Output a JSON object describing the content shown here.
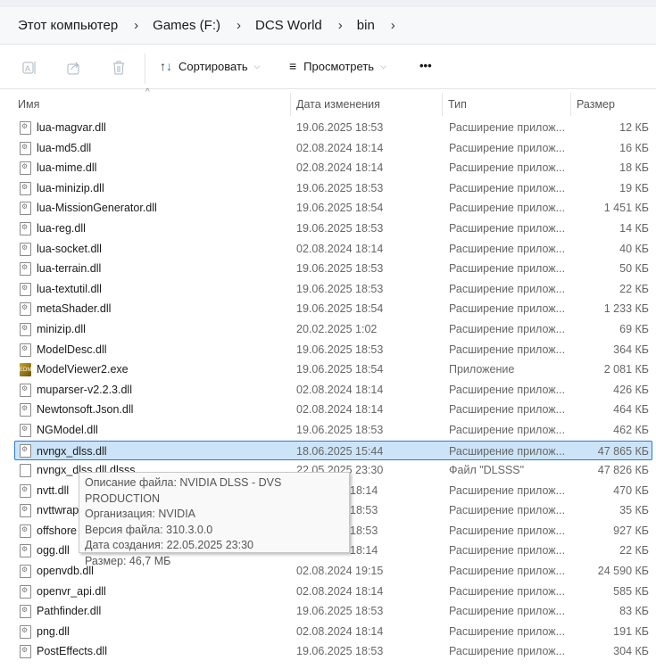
{
  "breadcrumb": [
    "Этот компьютер",
    "Games (F:)",
    "DCS World",
    "bin"
  ],
  "toolbar": {
    "sort_label": "Сортировать",
    "view_label": "Просмотреть",
    "more_label": "•••"
  },
  "columns": {
    "name": "Имя",
    "date": "Дата изменения",
    "type": "Тип",
    "size": "Размер"
  },
  "files": [
    {
      "name": "lua-magvar.dll",
      "date": "19.06.2025 18:53",
      "type": "Расширение прилож...",
      "size": "12 КБ",
      "icon": "dll"
    },
    {
      "name": "lua-md5.dll",
      "date": "02.08.2024 18:14",
      "type": "Расширение прилож...",
      "size": "16 КБ",
      "icon": "dll"
    },
    {
      "name": "lua-mime.dll",
      "date": "02.08.2024 18:14",
      "type": "Расширение прилож...",
      "size": "18 КБ",
      "icon": "dll"
    },
    {
      "name": "lua-minizip.dll",
      "date": "19.06.2025 18:53",
      "type": "Расширение прилож...",
      "size": "19 КБ",
      "icon": "dll"
    },
    {
      "name": "lua-MissionGenerator.dll",
      "date": "19.06.2025 18:54",
      "type": "Расширение прилож...",
      "size": "1 451 КБ",
      "icon": "dll"
    },
    {
      "name": "lua-reg.dll",
      "date": "19.06.2025 18:53",
      "type": "Расширение прилож...",
      "size": "14 КБ",
      "icon": "dll"
    },
    {
      "name": "lua-socket.dll",
      "date": "02.08.2024 18:14",
      "type": "Расширение прилож...",
      "size": "40 КБ",
      "icon": "dll"
    },
    {
      "name": "lua-terrain.dll",
      "date": "19.06.2025 18:53",
      "type": "Расширение прилож...",
      "size": "50 КБ",
      "icon": "dll"
    },
    {
      "name": "lua-textutil.dll",
      "date": "19.06.2025 18:53",
      "type": "Расширение прилож...",
      "size": "22 КБ",
      "icon": "dll"
    },
    {
      "name": "metaShader.dll",
      "date": "19.06.2025 18:54",
      "type": "Расширение прилож...",
      "size": "1 233 КБ",
      "icon": "dll"
    },
    {
      "name": "minizip.dll",
      "date": "20.02.2025 1:02",
      "type": "Расширение прилож...",
      "size": "69 КБ",
      "icon": "dll"
    },
    {
      "name": "ModelDesc.dll",
      "date": "19.06.2025 18:53",
      "type": "Расширение прилож...",
      "size": "364 КБ",
      "icon": "dll"
    },
    {
      "name": "ModelViewer2.exe",
      "date": "19.06.2025 18:54",
      "type": "Приложение",
      "size": "2 081 КБ",
      "icon": "exe"
    },
    {
      "name": "muparser-v2.2.3.dll",
      "date": "02.08.2024 18:14",
      "type": "Расширение прилож...",
      "size": "426 КБ",
      "icon": "dll"
    },
    {
      "name": "Newtonsoft.Json.dll",
      "date": "02.08.2024 18:14",
      "type": "Расширение прилож...",
      "size": "464 КБ",
      "icon": "dll"
    },
    {
      "name": "NGModel.dll",
      "date": "19.06.2025 18:53",
      "type": "Расширение прилож...",
      "size": "462 КБ",
      "icon": "dll"
    },
    {
      "name": "nvngx_dlss.dll",
      "date": "18.06.2025 15:44",
      "type": "Расширение прилож...",
      "size": "47 865 КБ",
      "icon": "dll",
      "selected": true
    },
    {
      "name": "nvngx_dlss.dll.dlsss",
      "date": "22.05.2025 23:30",
      "type": "Файл \"DLSSS\"",
      "size": "47 826 КБ",
      "icon": "plain"
    },
    {
      "name": "nvtt.dll",
      "date": "18:14",
      "type": "Расширение прилож...",
      "size": "470 КБ",
      "icon": "dll",
      "partial": true
    },
    {
      "name": "nvttwrap",
      "date": "18:53",
      "type": "Расширение прилож...",
      "size": "35 КБ",
      "icon": "dll",
      "partial": true
    },
    {
      "name": "offshore",
      "date": "18:53",
      "type": "Расширение прилож...",
      "size": "927 КБ",
      "icon": "dll",
      "partial": true
    },
    {
      "name": "ogg.dll",
      "date": "18:14",
      "type": "Расширение прилож...",
      "size": "22 КБ",
      "icon": "dll",
      "partial": true
    },
    {
      "name": "openvdb.dll",
      "date": "02.08.2024 19:15",
      "type": "Расширение прилож...",
      "size": "24 590 КБ",
      "icon": "dll"
    },
    {
      "name": "openvr_api.dll",
      "date": "02.08.2024 18:14",
      "type": "Расширение прилож...",
      "size": "585 КБ",
      "icon": "dll"
    },
    {
      "name": "Pathfinder.dll",
      "date": "19.06.2025 18:53",
      "type": "Расширение прилож...",
      "size": "83 КБ",
      "icon": "dll"
    },
    {
      "name": "png.dll",
      "date": "02.08.2024 18:14",
      "type": "Расширение прилож...",
      "size": "191 КБ",
      "icon": "dll"
    },
    {
      "name": "PostEffects.dll",
      "date": "19.06.2025 18:53",
      "type": "Расширение прилож...",
      "size": "304 КБ",
      "icon": "dll"
    }
  ],
  "tooltip": [
    "Описание файла: NVIDIA DLSS - DVS PRODUCTION",
    "Организация: NVIDIA",
    "Версия файла: 310.3.0.0",
    "Дата создания: 22.05.2025 23:30",
    "Размер: 46,7 МБ"
  ],
  "colors": {
    "selection_bg": "#cce4f7",
    "selection_border": "#2d7bd0"
  }
}
